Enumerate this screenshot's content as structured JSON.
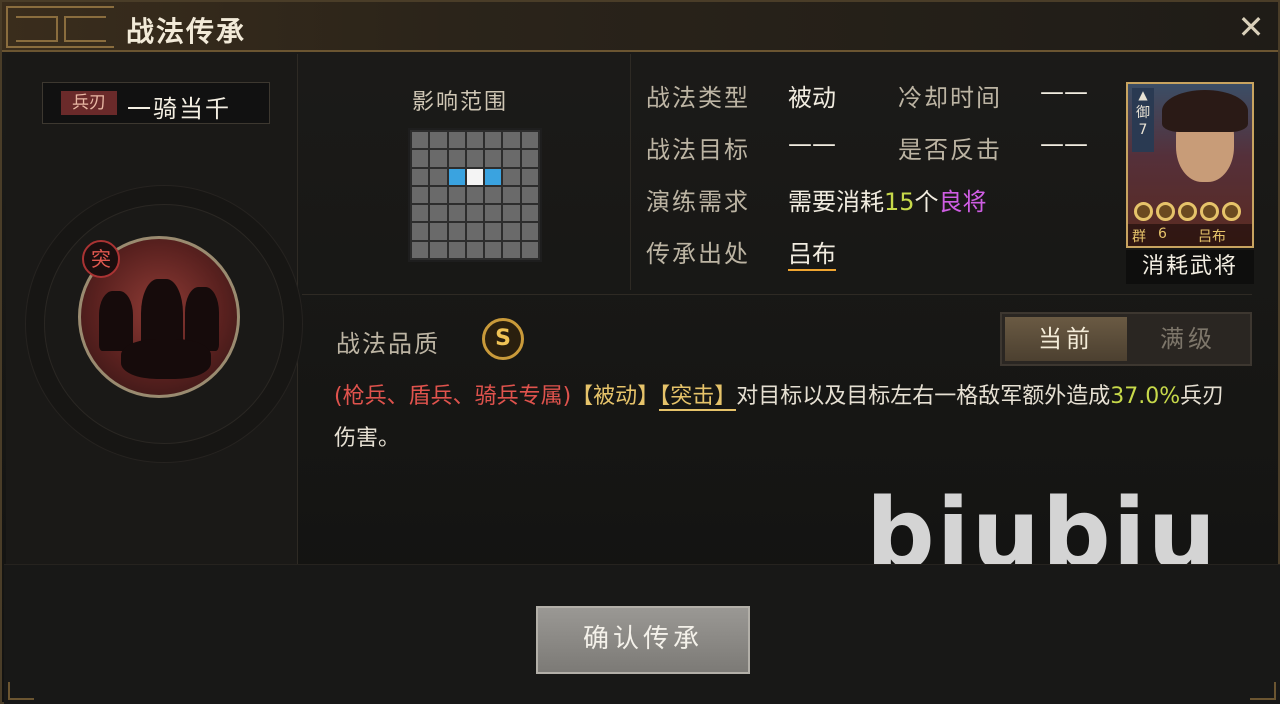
{
  "window": {
    "title": "战法传承",
    "close_symbol": "✕"
  },
  "skill": {
    "weapon_tag": "兵刃",
    "name": "一骑当千",
    "charge_badge": "突"
  },
  "range": {
    "title": "影响范围",
    "grid_size": 7,
    "target_cell": [
      2,
      3
    ],
    "side_cells": [
      [
        2,
        2
      ],
      [
        2,
        4
      ]
    ],
    "colors": {
      "cell": "#6a6a6a",
      "target": "#f4f4f4",
      "side": "#3aa3e0"
    }
  },
  "info": {
    "type_label": "战法类型",
    "type_value": "被动",
    "cooldown_label": "冷却时间",
    "cooldown_value": "——",
    "target_label": "战法目标",
    "target_value": "——",
    "counter_label": "是否反击",
    "counter_value": "——",
    "require_label": "演练需求",
    "require_prefix": "需要消耗",
    "require_count": "15",
    "require_unit": "个",
    "require_item": "良将",
    "origin_label": "传承出处",
    "origin_value": "吕布"
  },
  "general_card": {
    "type": "御",
    "cost": "7",
    "faction": "群",
    "level": "6",
    "name": "吕布",
    "stars": 5,
    "consume_label": "消耗武将"
  },
  "quality": {
    "label": "战法品质",
    "grade": "S"
  },
  "level_toggle": {
    "current": "当前",
    "max": "满级",
    "selected": "current"
  },
  "description": {
    "troops": "(枪兵、盾兵、骑兵专属)",
    "passive": "【被动】",
    "charge": "【突击】",
    "text_before_pct": "对目标以及目标左右一格敌军额外造成",
    "percent": "37.0%",
    "text_after_pct": "兵刃伤害。"
  },
  "watermark": "biubiu",
  "footer": {
    "confirm_label": "确认传承"
  }
}
